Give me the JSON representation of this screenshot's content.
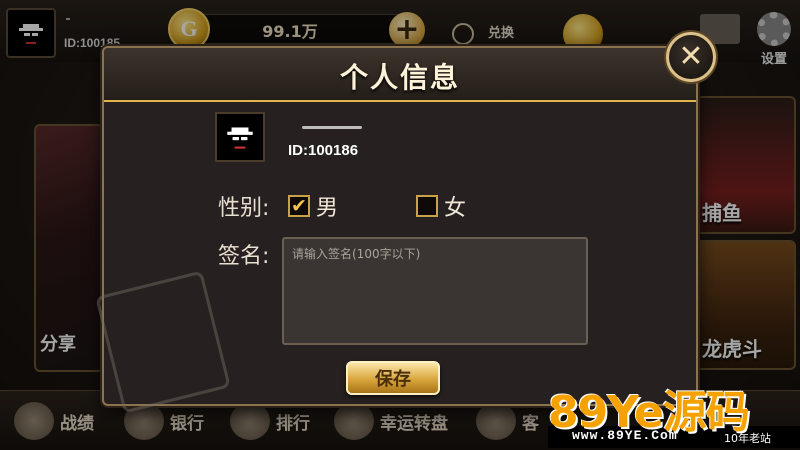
{
  "top_bar": {
    "user_id": "ID:100185",
    "coins": "99.1万",
    "coin_icon_letter": "G",
    "add_symbol": "+",
    "exchange_label": "兑换",
    "settings_label": "设置"
  },
  "side_cards": {
    "left_label": "分享",
    "right_top_label": "捕鱼",
    "right_bottom_label": "龙虎斗"
  },
  "bottom_bar": {
    "items": [
      {
        "label": "战绩"
      },
      {
        "label": "银行"
      },
      {
        "label": "排行"
      },
      {
        "label": "幸运转盘"
      },
      {
        "label": "客"
      }
    ]
  },
  "dialog": {
    "title": "个人信息",
    "close_symbol": "✕",
    "profile": {
      "id": "ID:100186"
    },
    "gender": {
      "label": "性别:",
      "options": [
        {
          "label": "男",
          "checked": true,
          "check_symbol": "✔"
        },
        {
          "label": "女",
          "checked": false,
          "check_symbol": ""
        }
      ]
    },
    "signature": {
      "label": "签名:",
      "value": "",
      "placeholder": "请输入签名(100字以下)"
    },
    "save_label": "保存"
  },
  "watermark": {
    "logo": "89Ye源码",
    "site": "www.89YE.Com",
    "slogan": "10年老站"
  },
  "colors": {
    "accent_gold": "#e2b64a",
    "dialog_bg": "#262120",
    "watermark_orange": "#f5a200"
  }
}
